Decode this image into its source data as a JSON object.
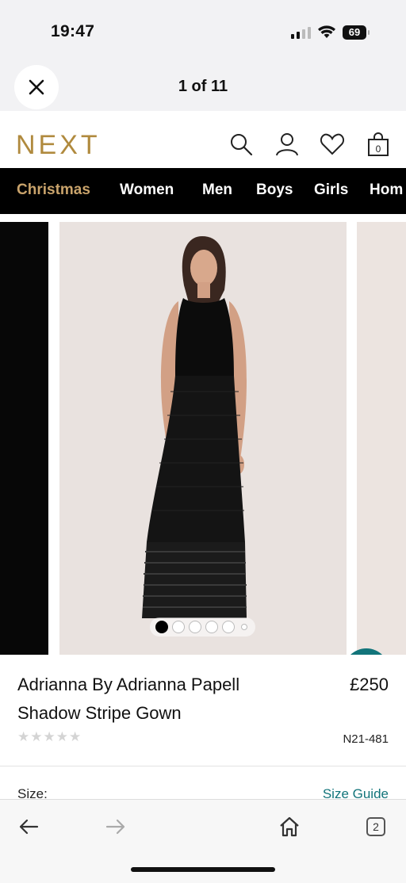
{
  "status_bar": {
    "time": "19:47",
    "battery": "69"
  },
  "viewer": {
    "counter": "1 of 11"
  },
  "header": {
    "logo": "NEXT",
    "basket_count": "0"
  },
  "nav": {
    "items": [
      "Christmas",
      "Women",
      "Men",
      "Boys",
      "Girls",
      "Hom"
    ]
  },
  "gallery": {
    "image_count": 6,
    "active_index": 0
  },
  "product": {
    "title_line1": "Adrianna By Adrianna Papell",
    "title_line2": "Shadow Stripe Gown",
    "price": "£250",
    "rating_stars": "★★★★★",
    "code": "N21-481",
    "size_label": "Size:",
    "size_guide": "Size Guide"
  },
  "toolbar": {
    "tabs_count": "2"
  },
  "colors": {
    "brand_gold": "#b08a3e",
    "accent_teal": "#12747a",
    "nav_bg": "#000000",
    "christmas": "#c9a36b"
  }
}
